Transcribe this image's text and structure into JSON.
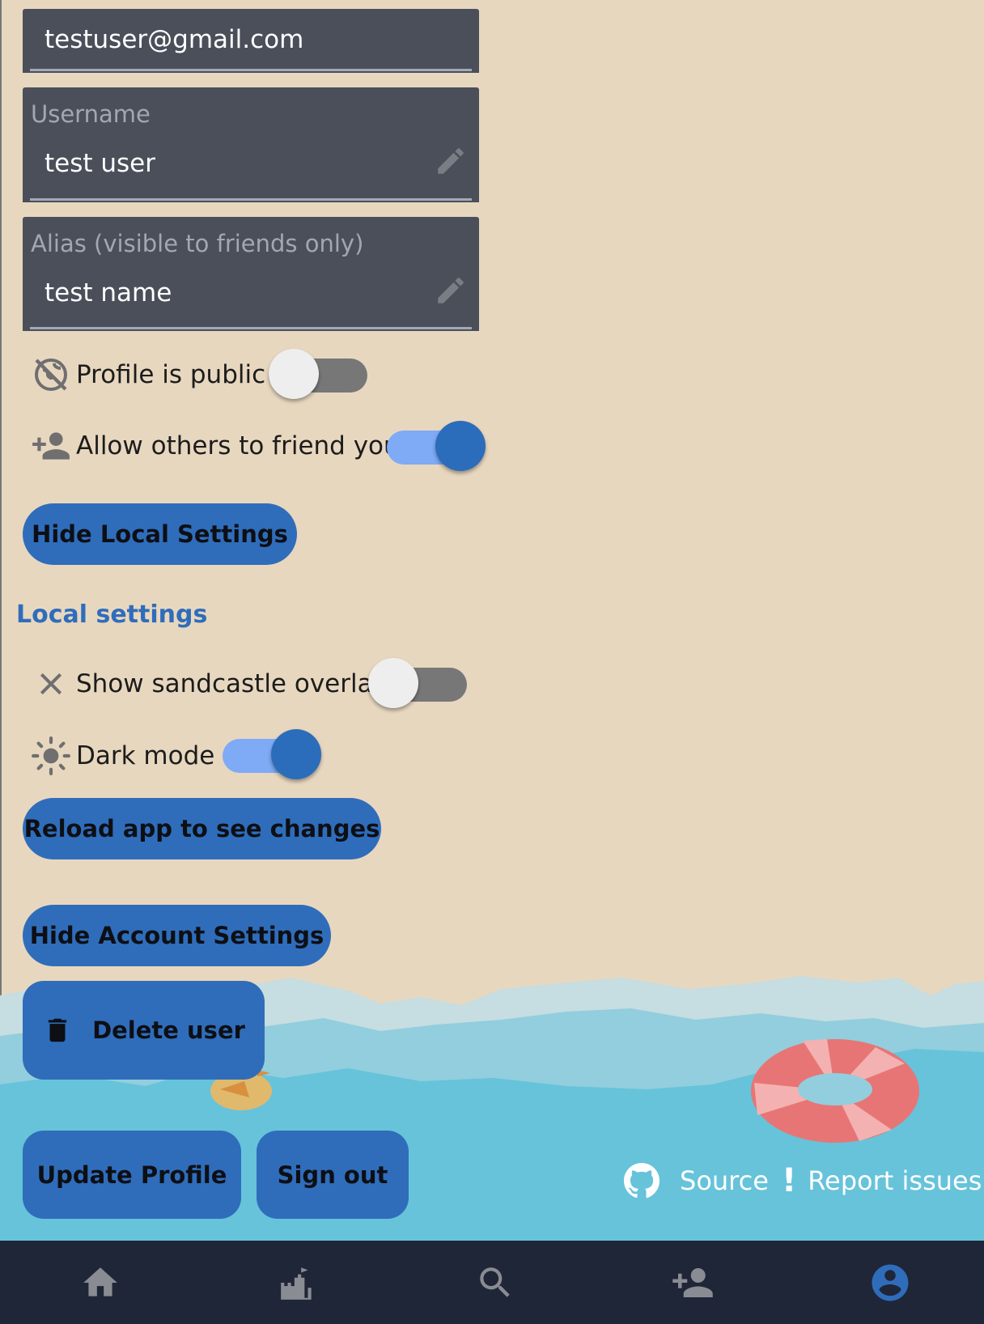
{
  "account": {
    "email_value": "testuser@gmail.com",
    "username": {
      "label": "Username",
      "value": "test user"
    },
    "alias": {
      "label": "Alias (visible to friends only)",
      "value": "test name"
    }
  },
  "toggles": {
    "profile_public": {
      "label": "Profile is public",
      "on": false,
      "icon": "public-off-icon"
    },
    "allow_friend": {
      "label": "Allow others to friend you",
      "on": true,
      "icon": "person-add-icon"
    }
  },
  "buttons": {
    "hide_local": "Hide Local Settings",
    "reload": "Reload app to see changes",
    "hide_account": "Hide Account Settings",
    "delete_user": "Delete user",
    "update_profile": "Update Profile",
    "sign_out": "Sign out"
  },
  "local_settings": {
    "title": "Local settings",
    "sandcastle_overlay": {
      "label": "Show sandcastle overlay",
      "on": false,
      "icon": "close-icon"
    },
    "dark_mode": {
      "label": "Dark mode",
      "on": true,
      "icon": "sun-icon"
    }
  },
  "footer": {
    "source": "Source",
    "report": "Report issues"
  },
  "nav": [
    "home-icon",
    "castle-icon",
    "search-icon",
    "add-friend-icon",
    "account-icon"
  ],
  "colors": {
    "background": "#e8d7bf",
    "accent": "#2f6dbb",
    "field": "#4a4f5a",
    "nav_bg": "#1f2637",
    "water": "#66c3da"
  }
}
